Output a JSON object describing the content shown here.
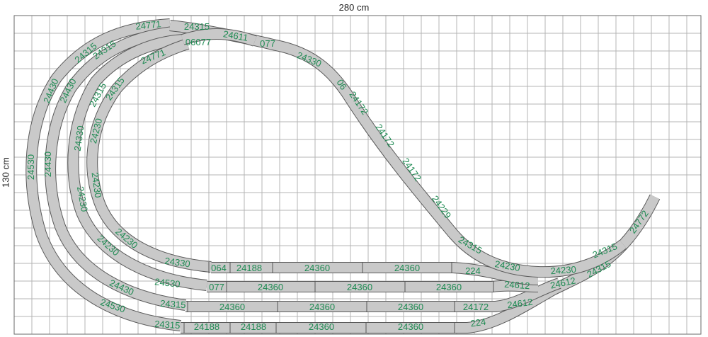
{
  "dimensions": {
    "width_label": "280 cm",
    "height_label": "130 cm"
  },
  "labels": [
    "24771",
    "24315",
    "24611",
    "24315",
    "24315",
    "06077",
    "077",
    "24330",
    "24771",
    "24315",
    "24315",
    "24430",
    "24430",
    "24330",
    "24230",
    "06",
    "24172",
    "24172",
    "24172",
    "24229",
    "24530",
    "24430",
    "24230",
    "24230",
    "24330",
    "24230",
    "24230",
    "064",
    "24188",
    "24360",
    "24360",
    "224",
    "24230",
    "24430",
    "24530",
    "077",
    "24360",
    "24360",
    "24360",
    "24612",
    "24530",
    "24315",
    "24360",
    "24360",
    "24360",
    "24172",
    "24612",
    "24315",
    "24188",
    "24188",
    "24360",
    "24360",
    "224",
    "24315",
    "24230",
    "24315",
    "24612",
    "24315",
    "24772"
  ],
  "colors": {
    "grid": "#b4b4b4",
    "track_fill": "#c8c8c8",
    "track_border": "#5a5a5a",
    "label": "#1e8a52"
  }
}
